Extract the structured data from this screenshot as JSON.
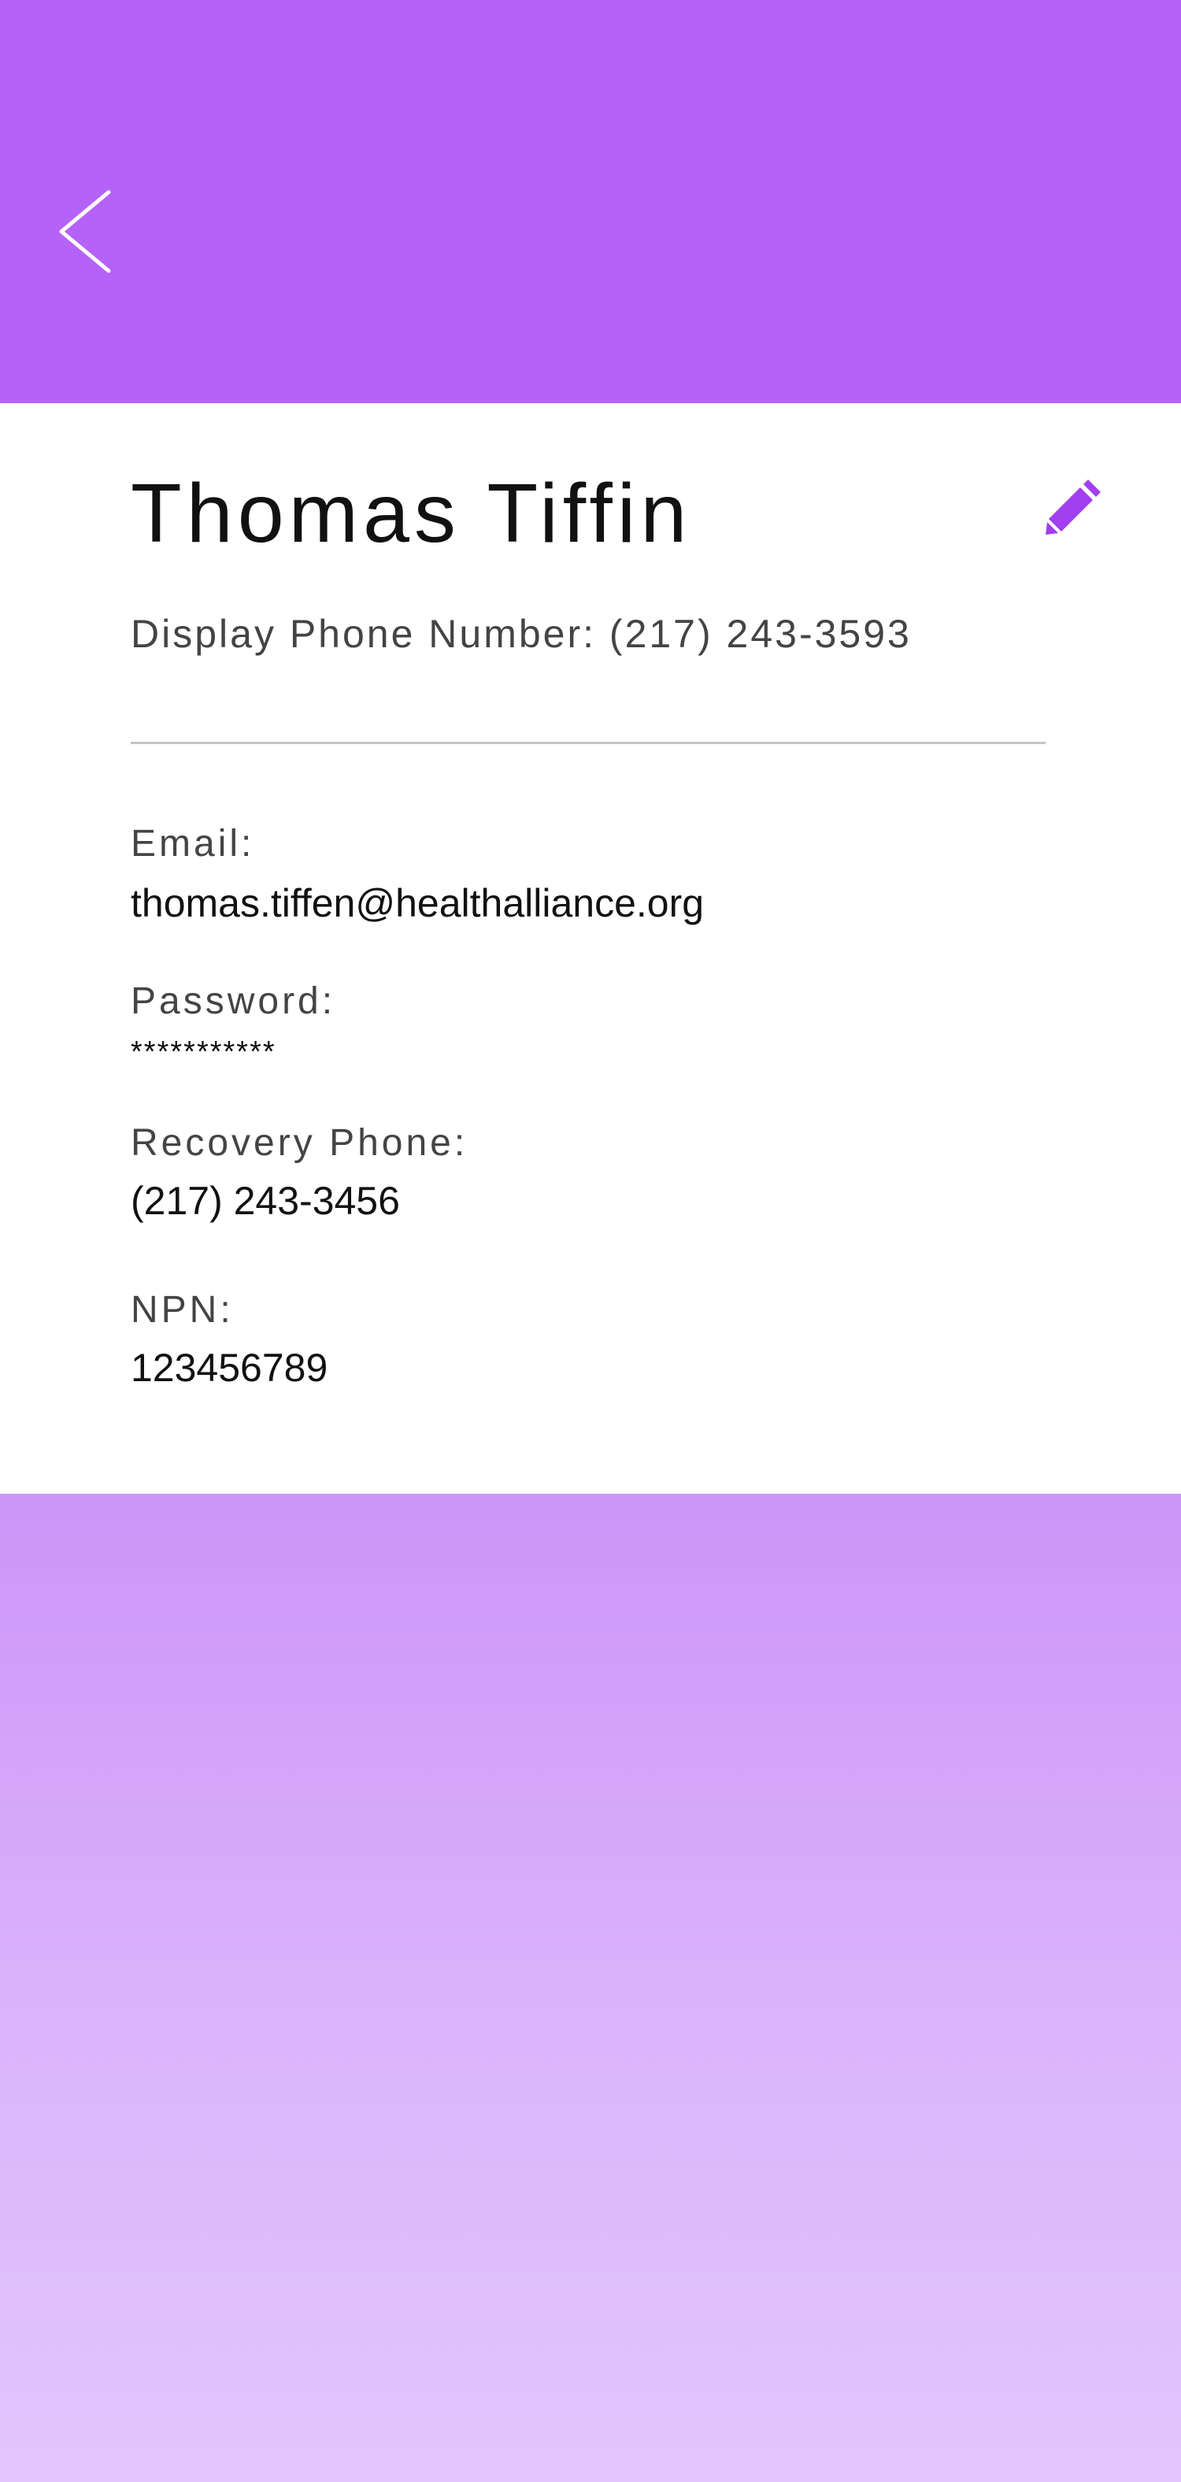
{
  "colors": {
    "header": "#b562f8",
    "accent": "#a23ff0",
    "gradient_top": "#cd94f8",
    "gradient_bottom": "#e3c6fd",
    "divider": "#c4c4c4"
  },
  "header": {
    "back_icon": "chevron-left-icon"
  },
  "profile": {
    "name": "Thomas Tiffin",
    "display_phone": "Display Phone Number: (217) 243-3593",
    "edit_icon": "pencil-icon"
  },
  "fields": {
    "email_label": "Email:",
    "email_value": "thomas.tiffen@healthalliance.org",
    "password_label": "Password:",
    "password_value": "***********",
    "recovery_label": "Recovery Phone:",
    "recovery_value": "(217) 243-3456",
    "npn_label": "NPN:",
    "npn_value": "123456789"
  }
}
